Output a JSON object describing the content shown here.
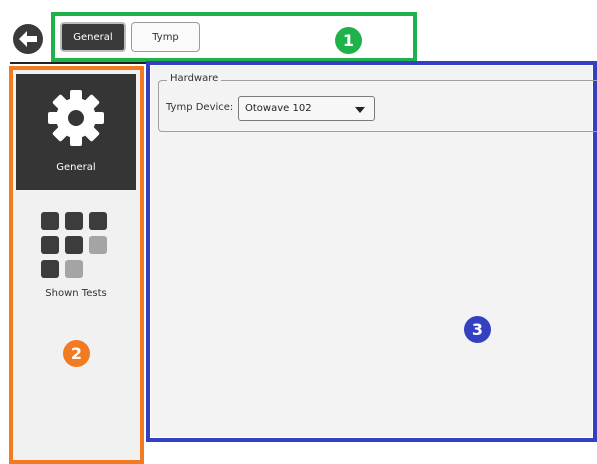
{
  "tabs": [
    {
      "label": "General",
      "active": true
    },
    {
      "label": "Tymp",
      "active": false
    }
  ],
  "nav": {
    "general": {
      "label": "General",
      "icon": "gear-icon"
    },
    "shown_tests": {
      "label": "Shown Tests",
      "icon": "grid-icon"
    }
  },
  "hardware": {
    "legend": "Hardware",
    "tymp_label": "Tymp Device:",
    "tymp_value": "Otowave 102"
  },
  "callouts": {
    "one": "1",
    "two": "2",
    "three": "3"
  },
  "colors": {
    "callout_1": "#1fb24a",
    "callout_2": "#f27a20",
    "callout_3": "#3340c0",
    "dark": "#353535"
  }
}
